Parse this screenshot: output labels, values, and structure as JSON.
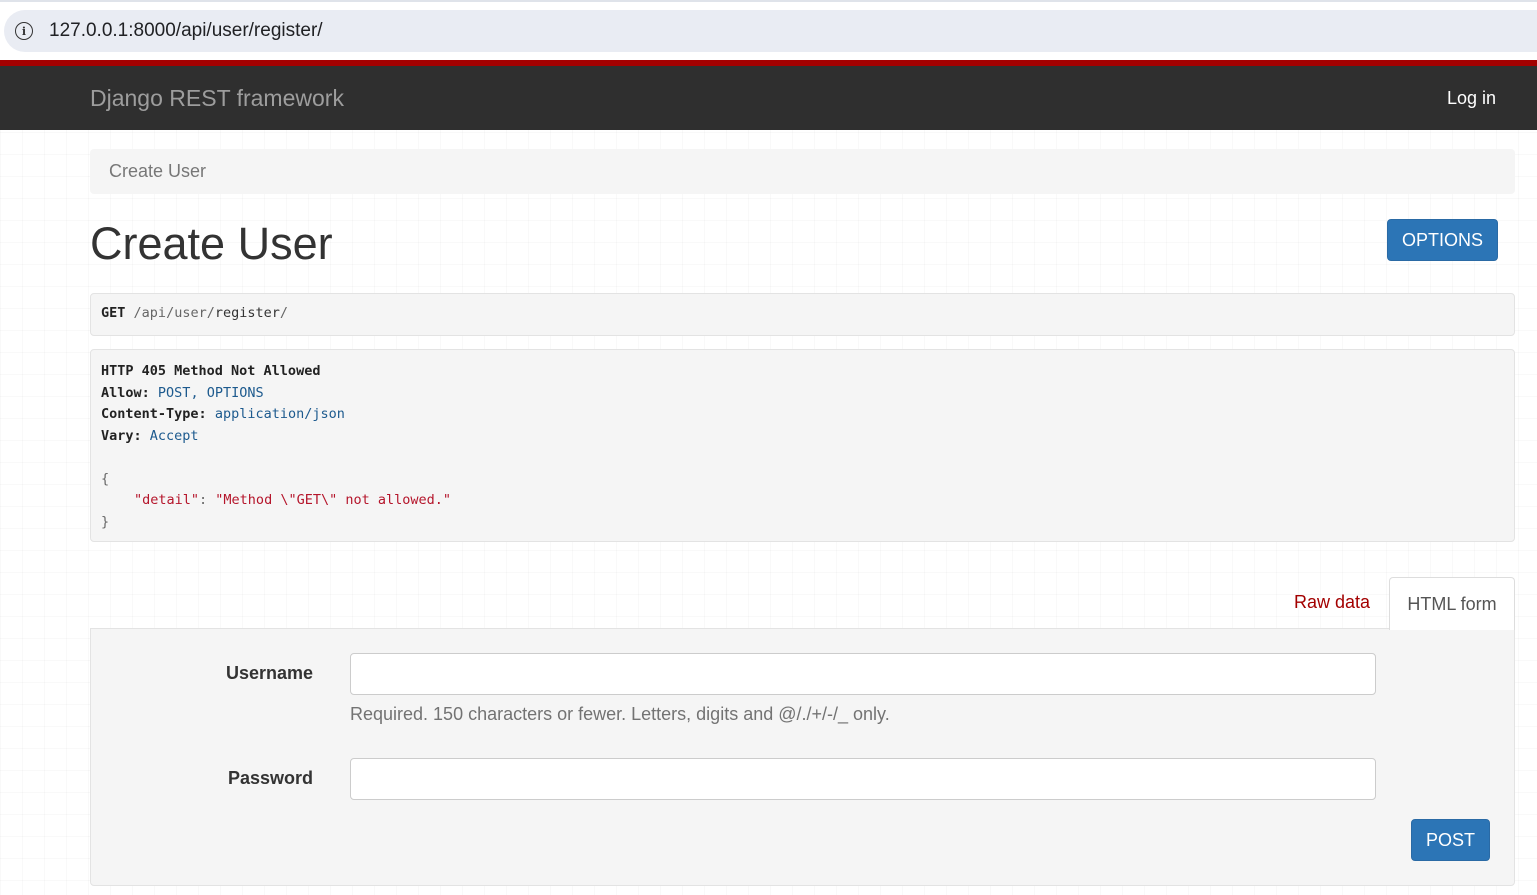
{
  "browser": {
    "url": "127.0.0.1:8000/api/user/register/"
  },
  "navbar": {
    "brand": "Django REST framework",
    "login_label": "Log in"
  },
  "breadcrumb": {
    "current": "Create User"
  },
  "page": {
    "title": "Create User",
    "options_label": "OPTIONS"
  },
  "request": {
    "method": "GET",
    "path_parts": [
      "/",
      "api",
      "/",
      "user",
      "/",
      "register",
      "/"
    ]
  },
  "response": {
    "status_line": "HTTP 405 Method Not Allowed",
    "headers": [
      {
        "name": "Allow:",
        "values": [
          "POST",
          ", ",
          "OPTIONS"
        ]
      },
      {
        "name": "Content-Type:",
        "values": [
          "application/json"
        ]
      },
      {
        "name": "Vary:",
        "values": [
          "Accept"
        ]
      }
    ],
    "body_open": "{",
    "body_key": "\"detail\"",
    "body_sep": ": ",
    "body_value": "\"Method \\\"GET\\\" not allowed.\"",
    "body_close": "}"
  },
  "tabs": {
    "raw_label": "Raw data",
    "html_label": "HTML form"
  },
  "form": {
    "username_label": "Username",
    "username_value": "",
    "username_help": "Required. 150 characters or fewer. Letters, digits and @/./+/-/_ only.",
    "password_label": "Password",
    "password_value": "",
    "submit_label": "POST"
  },
  "colors": {
    "navbar_bg": "#2f2f2f",
    "navbar_accent": "#a30000",
    "primary_button": "#2c75b6",
    "json_string": "#b5152b",
    "literal": "#1d5a8e"
  }
}
